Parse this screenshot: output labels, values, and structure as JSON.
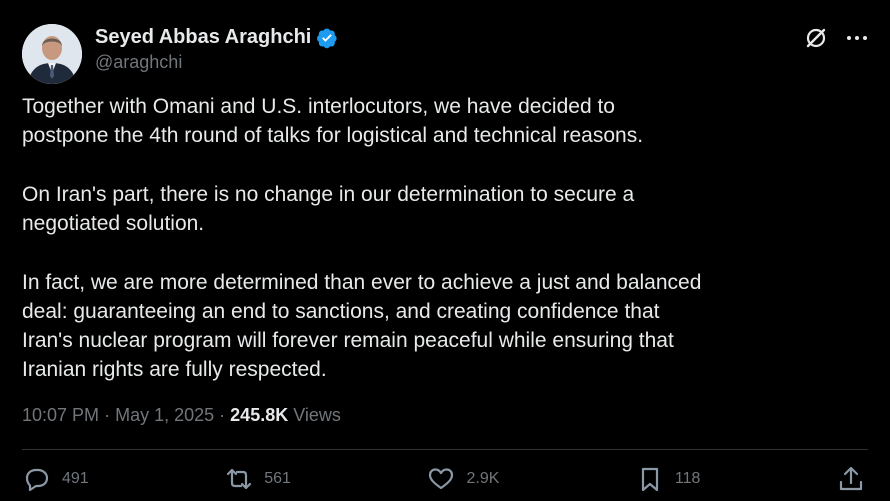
{
  "author": {
    "name": "Seyed Abbas Araghchi",
    "handle": "@araghchi",
    "verified_color": "#1d9bf0",
    "avatar_icon": "profile-photo"
  },
  "post": {
    "paragraphs": [
      "Together with Omani and U.S. interlocutors, we have decided to\npostpone the 4th round of talks for logistical and technical reasons.",
      "On Iran's part, there is no change in our determination to secure a\nnegotiated solution.",
      "In fact, we are more determined than ever to achieve a just and balanced\ndeal: guaranteeing an end to sanctions, and creating confidence that\nIran's nuclear program will forever remain peaceful while ensuring that\nIranian rights are fully respected."
    ],
    "time": "10:07 PM",
    "separator": "·",
    "date": "May 1, 2025",
    "views_count": "245.8K",
    "views_label": "Views"
  },
  "actions": {
    "replies": "491",
    "reposts": "561",
    "likes": "2.9K",
    "bookmarks": "118"
  },
  "colors": {
    "background": "#000000",
    "text": "#e7e9ea",
    "secondary": "#71767b",
    "accent": "#1d9bf0"
  }
}
